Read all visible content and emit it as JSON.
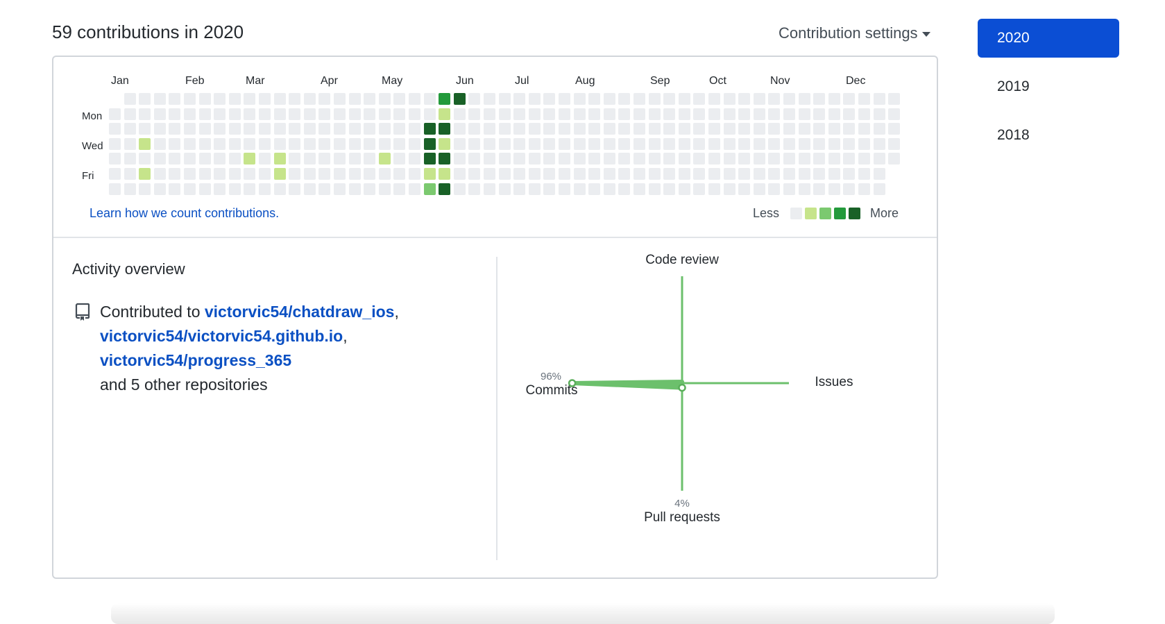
{
  "header": {
    "title": "59 contributions in 2020",
    "settings_label": "Contribution settings"
  },
  "calendar": {
    "months": [
      "Jan",
      "Feb",
      "Mar",
      "Apr",
      "May",
      "Jun",
      "Jul",
      "Aug",
      "Sep",
      "Oct",
      "Nov",
      "Dec"
    ],
    "day_labels": [
      "Mon",
      "Wed",
      "Fri"
    ],
    "weeks": 53,
    "first_week_start_row": 1,
    "last_week_end_row": 4,
    "colors": [
      "#ebedf0",
      "#c6e48b",
      "#7bc96f",
      "#239a3b",
      "#196127"
    ],
    "active_cells": [
      {
        "week": 21,
        "day": 2,
        "level": 4
      },
      {
        "week": 2,
        "day": 3,
        "level": 1
      },
      {
        "week": 9,
        "day": 4,
        "level": 1
      },
      {
        "week": 11,
        "day": 4,
        "level": 1
      },
      {
        "week": 2,
        "day": 5,
        "level": 1
      },
      {
        "week": 11,
        "day": 5,
        "level": 1
      },
      {
        "week": 18,
        "day": 4,
        "level": 1
      },
      {
        "week": 21,
        "day": 3,
        "level": 4
      },
      {
        "week": 21,
        "day": 4,
        "level": 4
      },
      {
        "week": 21,
        "day": 5,
        "level": 1
      },
      {
        "week": 21,
        "day": 6,
        "level": 2
      },
      {
        "week": 22,
        "day": 0,
        "level": 3
      },
      {
        "week": 22,
        "day": 1,
        "level": 1
      },
      {
        "week": 22,
        "day": 2,
        "level": 4
      },
      {
        "week": 22,
        "day": 3,
        "level": 1
      },
      {
        "week": 22,
        "day": 4,
        "level": 4
      },
      {
        "week": 22,
        "day": 5,
        "level": 1
      },
      {
        "week": 22,
        "day": 6,
        "level": 4
      },
      {
        "week": 23,
        "day": 0,
        "level": 4
      }
    ],
    "learn_link": "Learn how we count contributions.",
    "legend_less": "Less",
    "legend_more": "More"
  },
  "overview": {
    "title": "Activity overview",
    "contributed_to": "Contributed to",
    "repos": [
      "victorvic54/chatdraw_ios",
      "victorvic54/victorvic54.github.io",
      "victorvic54/progress_365"
    ],
    "others": "and 5 other repositories"
  },
  "radar": {
    "code_review": "Code review",
    "issues": "Issues",
    "commits": "Commits",
    "commits_pct": "96%",
    "pull_requests": "Pull requests",
    "pull_requests_pct": "4%",
    "commits_value": 0.96,
    "pull_requests_value": 0.04
  },
  "years": [
    "2020",
    "2019",
    "2018"
  ],
  "selected_year": "2020"
}
